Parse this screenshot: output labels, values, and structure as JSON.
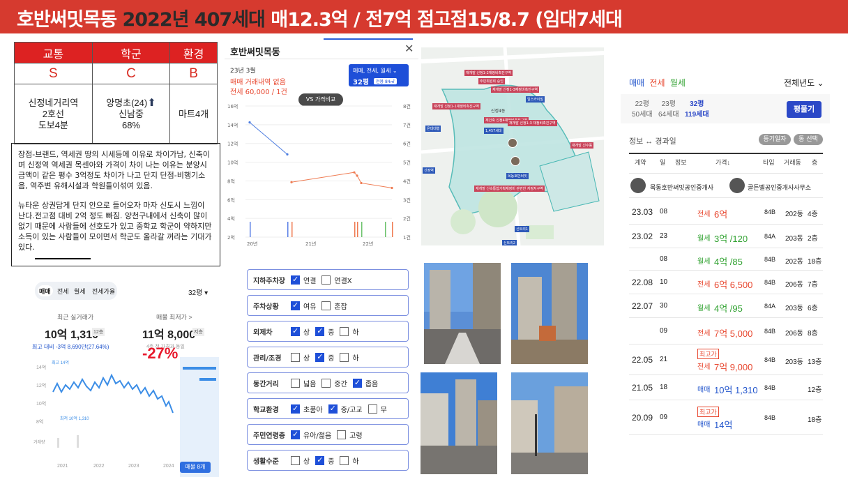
{
  "header": {
    "title_white": "호반써밋목동",
    "title_dark": "2022년 407세대",
    "title_white2": "매12.3억 / 전7억 점고점15/8.7 (임대7세대"
  },
  "ratings": {
    "headers": [
      "교통",
      "학군",
      "환경"
    ],
    "grades": [
      "S",
      "C",
      "B"
    ],
    "transport": [
      "신정네거리역",
      "2호선",
      "도보4분"
    ],
    "school": [
      "양명초(24)",
      "신남중",
      "68%"
    ],
    "env": "마트4개"
  },
  "description": {
    "p1": "장점-브랜드, 역세권 땅의 시세등에 이유로 차이가남, 신축이며 신정역 역세권 목센아와 가격이 차이 나는 이유는 분양시 금액이 같은 평수 3억정도 차이가 나고 단지 단점-비행기소음, 역주변 유해시설과 학원들이섞여 있음.",
    "p2": "뉴타운 상권답게 단지 안으로 들어오자 마자 신도시 느낌이 난다.전고점 대비 2억 정도 빠짐. 양천구내에서 신축이 많이 없기 때문에 사람들에 선호도가 있고 중학교 학군이 약하지만 소득이 있는 사람들이 모이면서 학군도 올라갈 꺼라는 기대가 있다."
  },
  "popup": {
    "title": "호반써밋목동",
    "date": "23년 3월",
    "no_trade": "매매 거래내역 없음",
    "jeonse": "전세 60,000 / 1건",
    "filter": "매매, 전세, 월세 ⌄",
    "size": "32평",
    "size_sub": "전용 84㎡",
    "compare_btn": "VS 가격비교",
    "y_left": [
      "16억",
      "14억",
      "12억",
      "10억",
      "8억",
      "6억",
      "4억",
      "2억"
    ],
    "y_right": [
      "8건",
      "7건",
      "6건",
      "5건",
      "4건",
      "3건",
      "2건",
      "1건"
    ],
    "x": [
      "20년",
      "21년",
      "22년"
    ]
  },
  "price_panel": {
    "tabs": [
      "매매",
      "전세",
      "월세",
      "전세가율"
    ],
    "size": "32평 ▾",
    "recent_label": "최근 실거래가",
    "recent": "10억 1,310",
    "recent_badge": "12층",
    "ask_label": "매물 최저가 >",
    "ask": "11억 8,000",
    "ask_badge": "저층",
    "diff": "최고 대비 -3억 8,690만(27.64%)",
    "diff_sub": "4주 전 가격과 동일",
    "pct": "-27%",
    "max_label": "최고 14억",
    "min_label": "최저 10억 1,310",
    "y": [
      "14억",
      "12억",
      "10억",
      "8억"
    ],
    "y_extra": [
      "거래량"
    ],
    "x": [
      "2021",
      "2022",
      "2023",
      "2024"
    ],
    "listing_btn": "매물 8개"
  },
  "checklist": [
    {
      "label": "지하주차장",
      "opts": [
        {
          "t": "연결",
          "on": true
        },
        {
          "t": "연결X",
          "on": false
        }
      ]
    },
    {
      "label": "주차상황",
      "opts": [
        {
          "t": "여유",
          "on": true
        },
        {
          "t": "혼잡",
          "on": false
        }
      ]
    },
    {
      "label": "외제차",
      "opts": [
        {
          "t": "상",
          "on": true
        },
        {
          "t": "중",
          "on": true
        },
        {
          "t": "하",
          "on": false
        }
      ]
    },
    {
      "label": "관리/조경",
      "opts": [
        {
          "t": "상",
          "on": false
        },
        {
          "t": "중",
          "on": true
        },
        {
          "t": "하",
          "on": false
        }
      ]
    },
    {
      "label": "동간거리",
      "opts": [
        {
          "t": "넓음",
          "on": false
        },
        {
          "t": "중간",
          "on": false
        },
        {
          "t": "좁음",
          "on": true
        }
      ]
    },
    {
      "label": "학교환경",
      "opts": [
        {
          "t": "초품아",
          "on": true
        },
        {
          "t": "중/고교",
          "on": true
        },
        {
          "t": "무",
          "on": false
        }
      ]
    },
    {
      "label": "주민연령층",
      "opts": [
        {
          "t": "유아/젊음",
          "on": true
        },
        {
          "t": "고령",
          "on": false
        }
      ]
    },
    {
      "label": "생활수준",
      "opts": [
        {
          "t": "상",
          "on": false
        },
        {
          "t": "중",
          "on": true
        },
        {
          "t": "하",
          "on": false
        }
      ]
    }
  ],
  "map": {
    "labels": [
      "목동호반써밋",
      "신정역",
      "신트리1",
      "신트리2",
      "온대대행",
      "일스카이빌",
      "신정4동"
    ]
  },
  "trades": {
    "tabs": [
      "매매",
      "전세",
      "월세"
    ],
    "all_years": "전체년도 ⌄",
    "sizes": [
      {
        "p": "22평",
        "u": "50세대"
      },
      {
        "p": "23평",
        "u": "64세대"
      },
      {
        "p": "32평",
        "u": "119세대"
      }
    ],
    "pyeong_btn": "평풀기",
    "info_toggle": "정보 ↔ 경과일",
    "btn1": "등기일자",
    "btn2": "동 선택",
    "cols": [
      "계약",
      "일",
      "정보",
      "가격↓",
      "타입",
      "거래동",
      "층"
    ],
    "agents": [
      "목동호반써밋공인중개사",
      "골든벨공인중개사사무소"
    ],
    "rows": [
      {
        "ym": "23.03",
        "d": "08",
        "kind": "전세",
        "price": "6억",
        "type": "84B",
        "dong": "202동",
        "floor": "4층",
        "color": "red",
        "badge": ""
      },
      {
        "ym": "23.02",
        "d": "23",
        "kind": "월세",
        "price": "3억 /120",
        "type": "84A",
        "dong": "203동",
        "floor": "2층",
        "color": "green",
        "badge": ""
      },
      {
        "ym": "",
        "d": "08",
        "kind": "월세",
        "price": "4억 /85",
        "type": "84B",
        "dong": "202동",
        "floor": "18층",
        "color": "green",
        "badge": ""
      },
      {
        "ym": "22.08",
        "d": "10",
        "kind": "전세",
        "price": "6억 6,500",
        "type": "84B",
        "dong": "206동",
        "floor": "7층",
        "color": "red",
        "badge": ""
      },
      {
        "ym": "22.07",
        "d": "30",
        "kind": "월세",
        "price": "4억 /95",
        "type": "84A",
        "dong": "203동",
        "floor": "6층",
        "color": "green",
        "badge": ""
      },
      {
        "ym": "",
        "d": "09",
        "kind": "전세",
        "price": "7억 5,000",
        "type": "84B",
        "dong": "206동",
        "floor": "8층",
        "color": "red",
        "badge": ""
      },
      {
        "ym": "22.05",
        "d": "21",
        "kind": "전세",
        "price": "7억 9,000",
        "type": "84B",
        "dong": "203동",
        "floor": "13층",
        "color": "red",
        "badge": "최고가"
      },
      {
        "ym": "21.05",
        "d": "18",
        "kind": "매매",
        "price": "10억 1,310",
        "type": "84B",
        "dong": "",
        "floor": "12층",
        "color": "blue",
        "badge": ""
      },
      {
        "ym": "20.09",
        "d": "09",
        "kind": "매매",
        "price": "14억",
        "type": "84B",
        "dong": "",
        "floor": "18층",
        "color": "blue",
        "badge": "최고가"
      }
    ]
  },
  "colors": {
    "header_bg": "#d63a2f",
    "accent_blue": "#1e4fd8",
    "red": "#e8472f",
    "green": "#2fa12f"
  }
}
